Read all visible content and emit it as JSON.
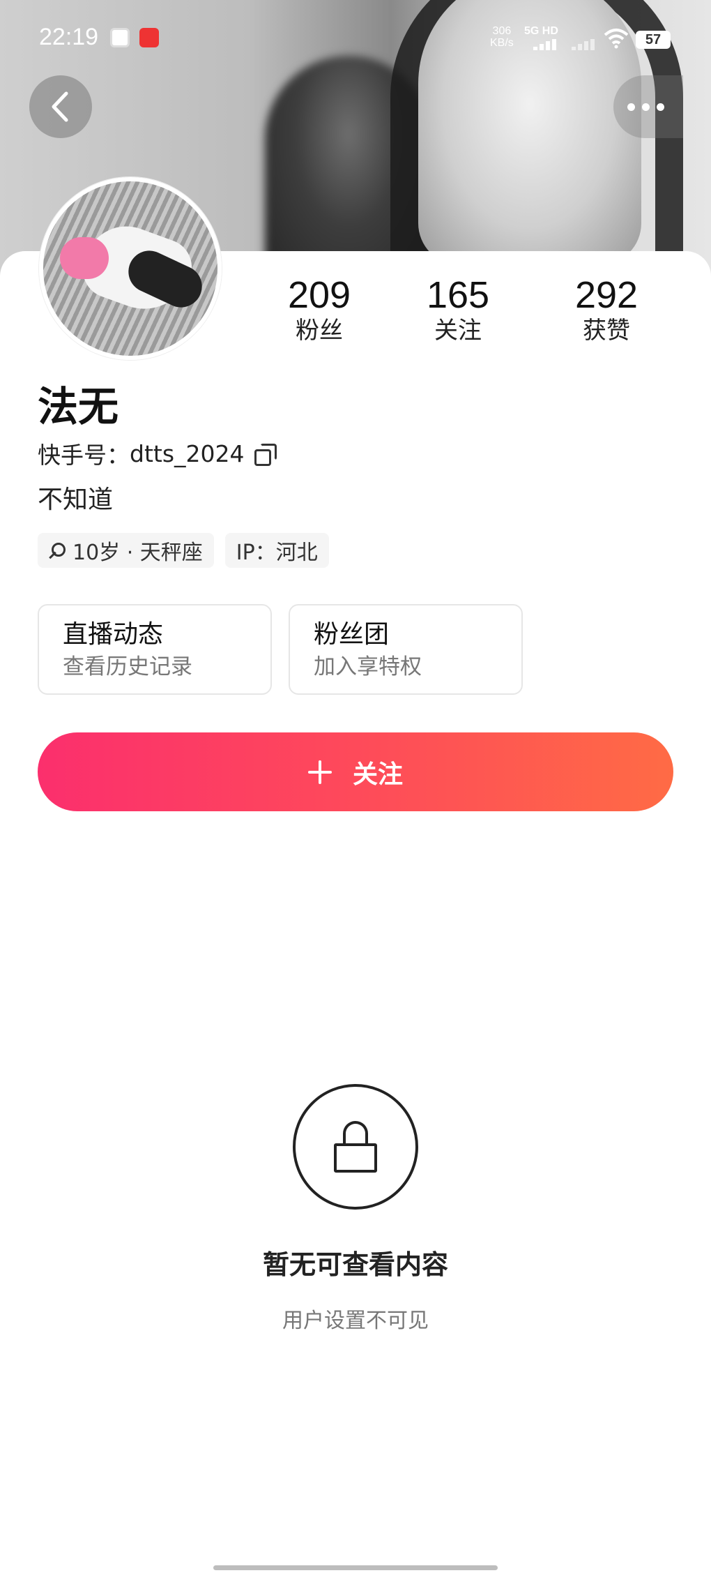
{
  "status_bar": {
    "time": "22:19",
    "net_speed_value": "306",
    "net_speed_unit": "KB/s",
    "net_type": "5G HD",
    "battery": "57"
  },
  "profile": {
    "stats": [
      {
        "value": "209",
        "label": "粉丝"
      },
      {
        "value": "165",
        "label": "关注"
      },
      {
        "value": "292",
        "label": "获赞"
      }
    ],
    "name": "法无",
    "id_label": "快手号：",
    "id_value": "dtts_2024",
    "bio": "不知道",
    "tags": {
      "age_constellation": "10岁 · 天秤座",
      "ip": "IP：河北"
    },
    "features": [
      {
        "title": "直播动态",
        "subtitle": "查看历史记录"
      },
      {
        "title": "粉丝团",
        "subtitle": "加入享特权"
      }
    ],
    "follow_label": "关注"
  },
  "empty_state": {
    "title": "暂无可查看内容",
    "subtitle": "用户设置不可见"
  },
  "icons": {
    "back": "chevron-left-icon",
    "more": "more-horizontal-icon",
    "copy": "copy-icon",
    "gender": "female-icon",
    "lock": "lock-icon",
    "plus": "plus-icon"
  },
  "colors": {
    "follow_gradient_start": "#fb2f6d",
    "follow_gradient_end": "#ff6b45"
  }
}
